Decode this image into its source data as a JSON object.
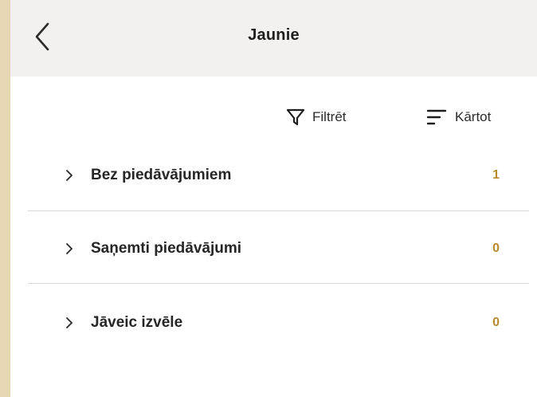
{
  "header": {
    "title": "Jaunie",
    "back_icon": "chevron-left-icon"
  },
  "toolbar": {
    "filter_label": "Filtrēt",
    "filter_icon": "filter-icon",
    "sort_label": "Kārtot",
    "sort_icon": "sort-icon"
  },
  "groups": [
    {
      "label": "Bez piedāvājumiem",
      "count": "1"
    },
    {
      "label": "Saņemti piedāvājumi",
      "count": "0"
    },
    {
      "label": "Jāveic izvēle",
      "count": "0"
    }
  ],
  "colors": {
    "accent": "#b88a2a",
    "header_bg": "#f2f1f0",
    "outer_bg": "#e6d6b3",
    "text": "#262626"
  }
}
